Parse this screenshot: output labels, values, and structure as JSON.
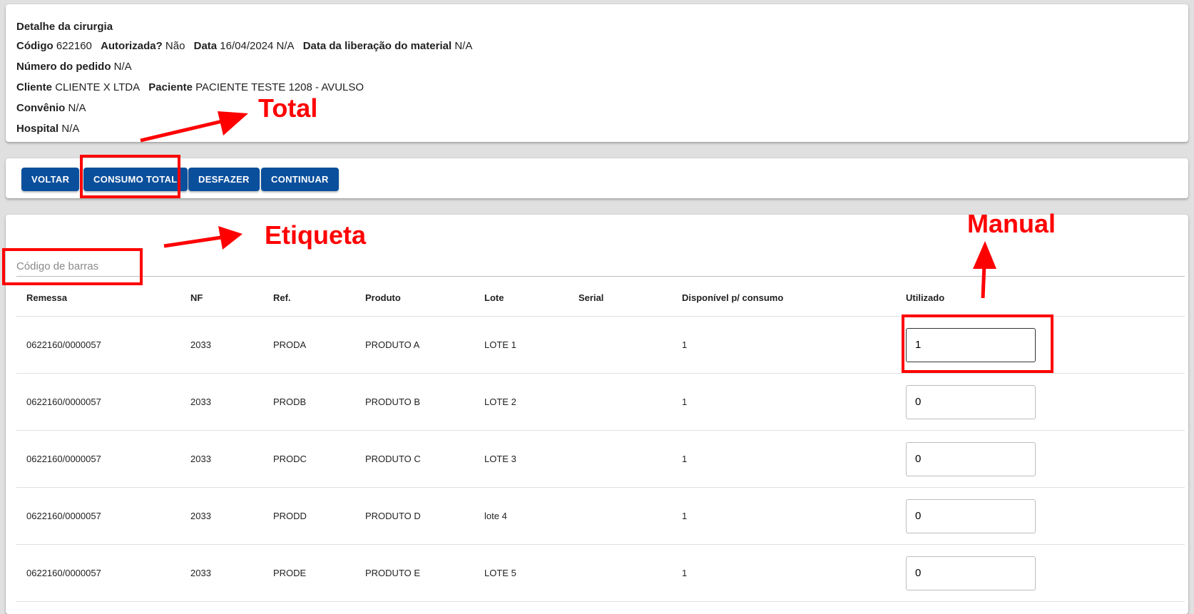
{
  "detail": {
    "title": "Detalhe da cirurgia",
    "codigo_label": "Código",
    "codigo": "622160",
    "autorizada_label": "Autorizada?",
    "autorizada": "Não",
    "data_label": "Data",
    "data": "16/04/2024 N/A",
    "liberacao_label": "Data da liberação do material",
    "liberacao": "N/A",
    "pedido_label": "Número do pedido",
    "pedido": "N/A",
    "cliente_label": "Cliente",
    "cliente": "CLIENTE X LTDA",
    "paciente_label": "Paciente",
    "paciente": "PACIENTE TESTE 1208 - AVULSO",
    "convenio_label": "Convênio",
    "convenio": "N/A",
    "hospital_label": "Hospital",
    "hospital": "N/A"
  },
  "actions": {
    "voltar": "VOLTAR",
    "consumo_total": "CONSUMO TOTAL",
    "desfazer": "DESFAZER",
    "continuar": "CONTINUAR"
  },
  "barcode": {
    "placeholder": "Código de barras",
    "value": ""
  },
  "table": {
    "headers": [
      "Remessa",
      "NF",
      "Ref.",
      "Produto",
      "Lote",
      "Serial",
      "Disponível p/ consumo",
      "Utilizado"
    ],
    "rows": [
      {
        "remessa": "0622160/0000057",
        "nf": "2033",
        "ref": "PRODA",
        "produto": "PRODUTO A",
        "lote": "LOTE 1",
        "serial": "",
        "disponivel": "1",
        "utilizado": "1"
      },
      {
        "remessa": "0622160/0000057",
        "nf": "2033",
        "ref": "PRODB",
        "produto": "PRODUTO B",
        "lote": "LOTE 2",
        "serial": "",
        "disponivel": "1",
        "utilizado": "0"
      },
      {
        "remessa": "0622160/0000057",
        "nf": "2033",
        "ref": "PRODC",
        "produto": "PRODUTO C",
        "lote": "LOTE 3",
        "serial": "",
        "disponivel": "1",
        "utilizado": "0"
      },
      {
        "remessa": "0622160/0000057",
        "nf": "2033",
        "ref": "PRODD",
        "produto": "PRODUTO D",
        "lote": "lote 4",
        "serial": "",
        "disponivel": "1",
        "utilizado": "0"
      },
      {
        "remessa": "0622160/0000057",
        "nf": "2033",
        "ref": "PRODE",
        "produto": "PRODUTO E",
        "lote": "LOTE 5",
        "serial": "",
        "disponivel": "1",
        "utilizado": "0"
      }
    ]
  },
  "annotations": {
    "total": "Total",
    "etiqueta": "Etiqueta",
    "manual": "Manual",
    "color": "#ff0000"
  }
}
